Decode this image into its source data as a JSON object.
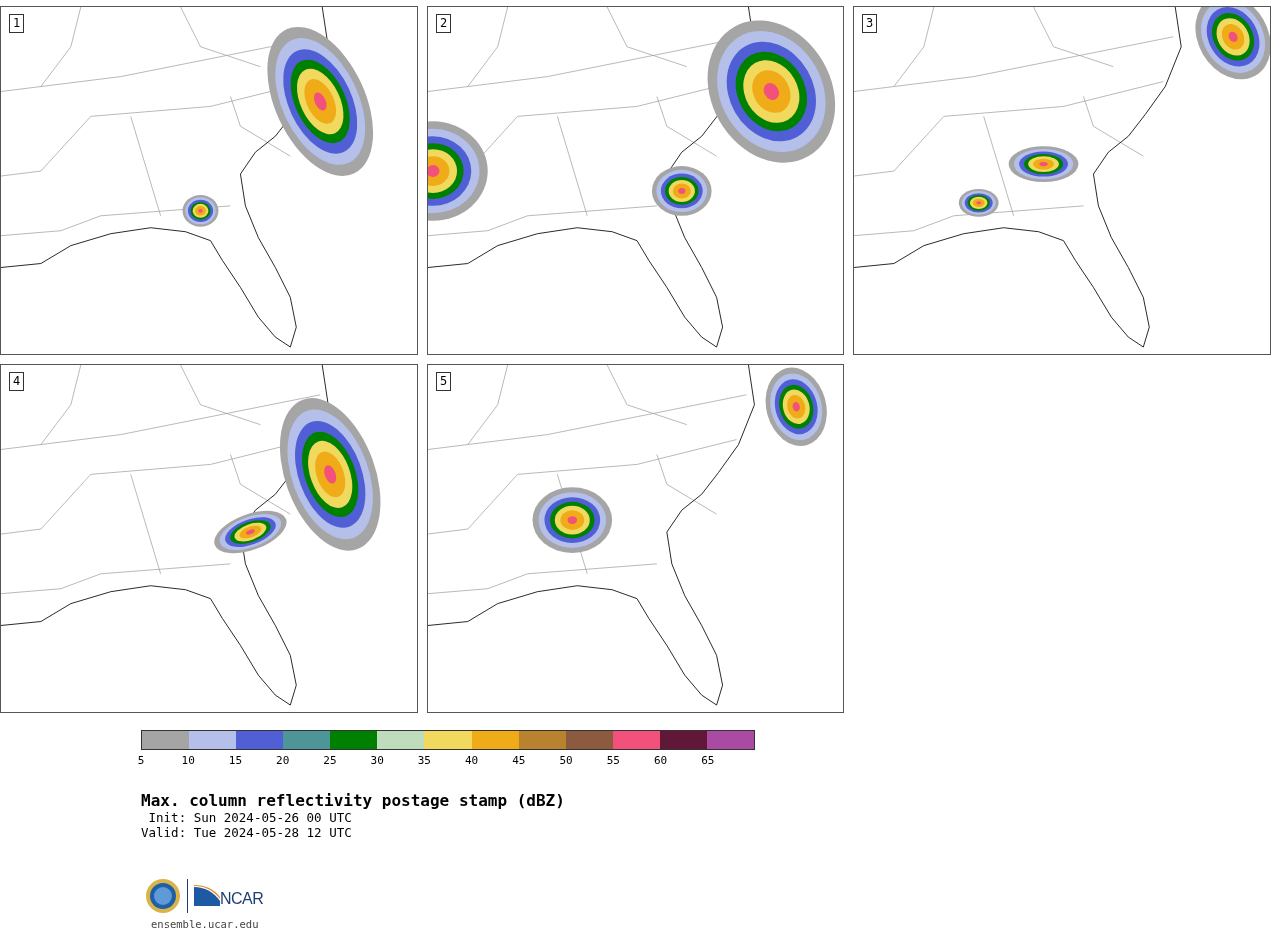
{
  "panels": [
    {
      "label": "1"
    },
    {
      "label": "2"
    },
    {
      "label": "3"
    },
    {
      "label": "4"
    },
    {
      "label": "5"
    }
  ],
  "colorbar": {
    "segments": [
      {
        "color": "#a5a5a5"
      },
      {
        "color": "#b4bfea"
      },
      {
        "color": "#505fd6"
      },
      {
        "color": "#4d9599"
      },
      {
        "color": "#008000"
      },
      {
        "color": "#bfddbd"
      },
      {
        "color": "#f0d95c"
      },
      {
        "color": "#f0ab18"
      },
      {
        "color": "#b8822f"
      },
      {
        "color": "#8b5a3f"
      },
      {
        "color": "#f2517c"
      },
      {
        "color": "#611838"
      },
      {
        "color": "#a94ba3"
      }
    ],
    "ticks": [
      "5",
      "10",
      "15",
      "20",
      "25",
      "30",
      "35",
      "40",
      "45",
      "50",
      "55",
      "60",
      "65"
    ]
  },
  "title": "Max. column reflectivity postage stamp (dBZ)",
  "init": " Init: Sun 2024-05-26 00 UTC",
  "valid": "Valid: Tue 2024-05-28 12 UTC",
  "logo": {
    "text": "NCAR"
  },
  "link": "ensemble.ucar.edu"
}
